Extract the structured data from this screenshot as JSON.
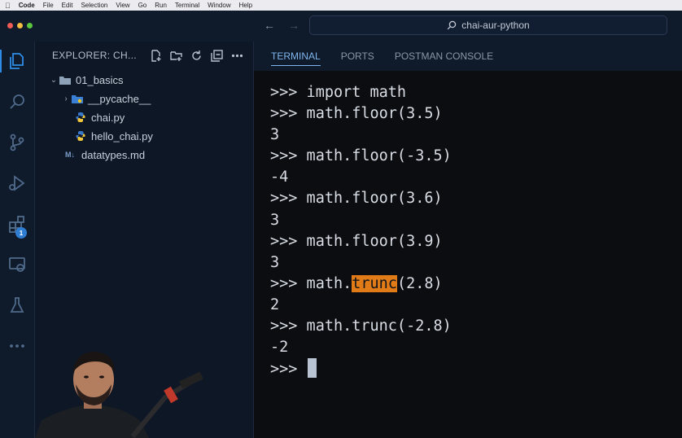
{
  "menubar": {
    "apple": "",
    "app": "Code",
    "items": [
      "File",
      "Edit",
      "Selection",
      "View",
      "Go",
      "Run",
      "Terminal",
      "Window",
      "Help"
    ]
  },
  "titlebar": {
    "back_icon": "arrow-left-icon",
    "forward_icon": "arrow-right-icon",
    "search_text": "chai-aur-python"
  },
  "activity": {
    "items": [
      "explorer-icon",
      "search-icon",
      "source-control-icon",
      "run-debug-icon",
      "extensions-icon",
      "remote-explorer-icon",
      "testing-icon",
      "more-icon"
    ],
    "extensions_badge": "1"
  },
  "sidebar": {
    "title": "EXPLORER: CH...",
    "tree": [
      {
        "label": "01_basics",
        "type": "folder",
        "expanded": true
      },
      {
        "label": "__pycache__",
        "type": "folder",
        "expanded": false
      },
      {
        "label": "chai.py",
        "type": "python"
      },
      {
        "label": "hello_chai.py",
        "type": "python"
      },
      {
        "label": "datatypes.md",
        "type": "markdown"
      }
    ]
  },
  "panel": {
    "tabs": [
      "TERMINAL",
      "PORTS",
      "POSTMAN CONSOLE"
    ],
    "active_tab": "TERMINAL"
  },
  "terminal": {
    "lines": [
      {
        "text": ">>> import math"
      },
      {
        "text": ">>> math.floor(3.5)"
      },
      {
        "text": "3"
      },
      {
        "text": ">>> math.floor(-3.5)"
      },
      {
        "text": "-4"
      },
      {
        "text": ">>> math.floor(3.6)"
      },
      {
        "text": "3"
      },
      {
        "text": ">>> math.floor(3.9)"
      },
      {
        "text": "3"
      },
      {
        "pre": ">>> math.",
        "highlight": "trunc",
        "post": "(2.8)"
      },
      {
        "text": "2"
      },
      {
        "text": ">>> math.trunc(-2.8)"
      },
      {
        "text": "-2"
      }
    ],
    "prompt": ">>> "
  },
  "colors": {
    "accent": "#2e8ce6",
    "highlight": "#e07b17",
    "terminal_bg": "#0b0d10"
  }
}
